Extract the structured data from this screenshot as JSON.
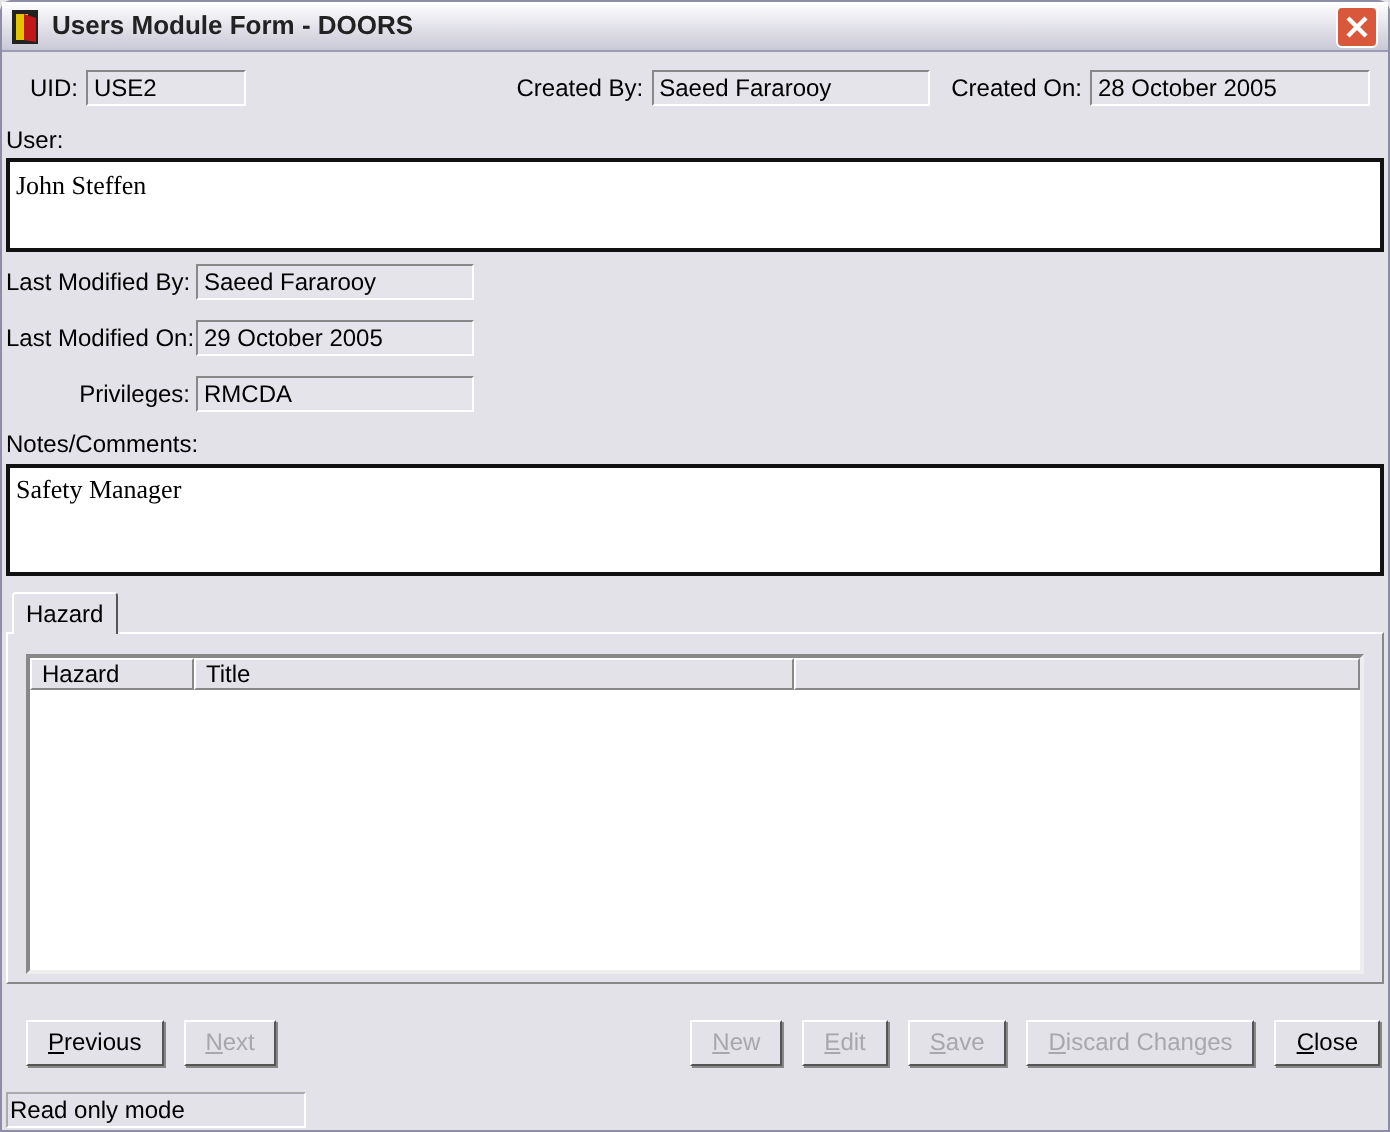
{
  "window": {
    "title": "Users Module Form - DOORS"
  },
  "uid": {
    "label": "UID:",
    "value": "USE2"
  },
  "created_by": {
    "label": "Created By:",
    "value": "Saeed Fararooy"
  },
  "created_on": {
    "label": "Created On:",
    "value": "28 October 2005"
  },
  "user": {
    "label": "User:",
    "value": "John Steffen"
  },
  "details": [
    {
      "label": "Last Modified By:",
      "value": "Saeed Fararooy"
    },
    {
      "label": "Last Modified On:",
      "value": "29 October 2005"
    },
    {
      "label": "Privileges:",
      "value": "RMCDA"
    }
  ],
  "notes": {
    "label": "Notes/Comments:",
    "value": "Safety Manager"
  },
  "tabs": [
    {
      "label": "Hazard",
      "selected": true
    }
  ],
  "table": {
    "columns": [
      "Hazard",
      "Title"
    ]
  },
  "nav_buttons": [
    {
      "label": "Previous",
      "disabled": false
    },
    {
      "label": "Next",
      "disabled": true
    }
  ],
  "action_buttons": [
    {
      "label": "New",
      "disabled": true
    },
    {
      "label": "Edit",
      "disabled": true
    },
    {
      "label": "Save",
      "disabled": true
    },
    {
      "label": "Discard Changes",
      "disabled": true
    },
    {
      "label": "Close",
      "disabled": false
    }
  ],
  "status_bar": "Read only mode"
}
